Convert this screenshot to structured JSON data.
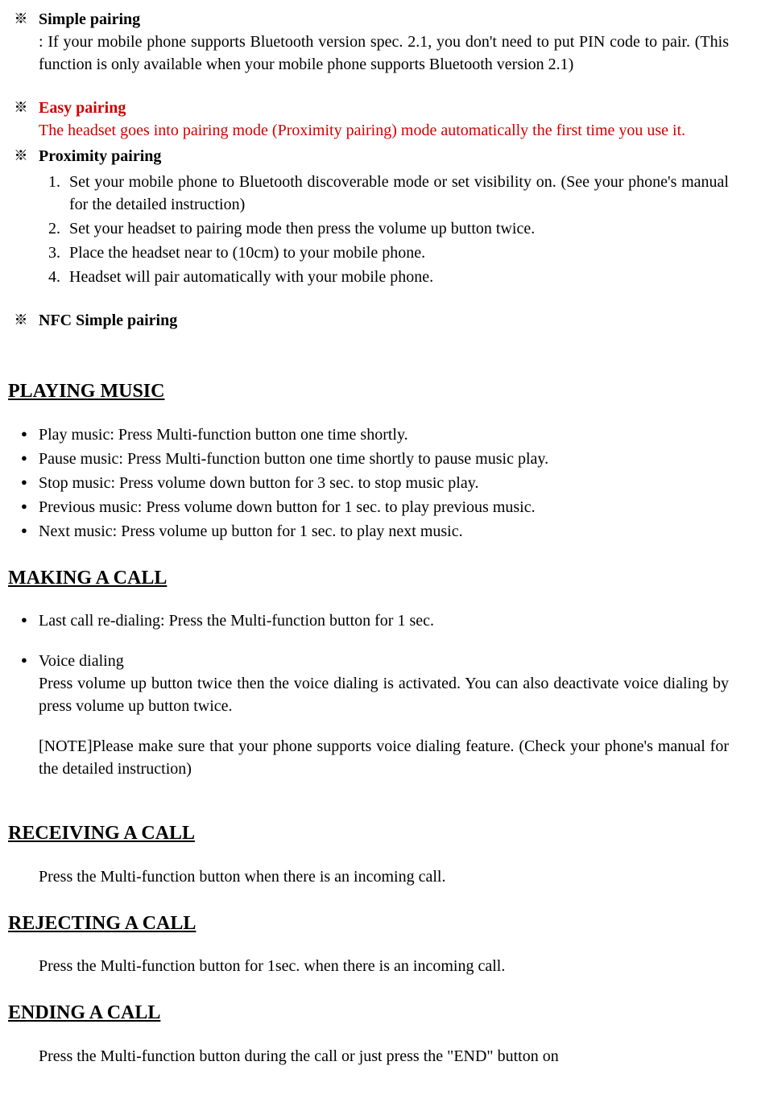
{
  "pairing": {
    "simple": {
      "title": "Simple pairing",
      "body": ": If your mobile phone supports Bluetooth version spec. 2.1, you don't need to put PIN code to pair. (This function is only available when your mobile phone supports Bluetooth version 2.1)"
    },
    "easy": {
      "title": "Easy pairing",
      "body": "The headset goes into pairing mode (Proximity pairing) mode automatically the first time you use it."
    },
    "proximity": {
      "title": "Proximity pairing",
      "steps": [
        "Set your mobile phone to Bluetooth discoverable mode or set visibility on. (See your phone's manual for the detailed instruction)",
        "Set your headset to pairing mode then press the volume up button twice.",
        "Place the headset near to (10cm) to your mobile phone.",
        "Headset will pair automatically with your mobile phone."
      ]
    },
    "nfc": {
      "title": "NFC Simple pairing"
    }
  },
  "playing": {
    "heading": "PLAYING MUSIC",
    "items": [
      "Play music: Press Multi-function button one time shortly.",
      "Pause music: Press Multi-function button one time shortly to pause music play.",
      "Stop music: Press volume down button for 3 sec. to stop music play.",
      "Previous music: Press volume down button for 1 sec. to play previous music.",
      "Next music: Press volume up button for 1 sec. to play next music."
    ]
  },
  "making": {
    "heading": "MAKING A CALL",
    "redial": "Last call re-dialing: Press the Multi-function button for 1 sec.",
    "voice_title": "Voice dialing",
    "voice_body": "Press volume up button twice then the voice dialing is activated. You can also deactivate voice dialing by press volume up button twice.",
    "voice_note": "[NOTE]Please make sure that your phone supports voice dialing feature. (Check your phone's manual for the detailed instruction)"
  },
  "receiving": {
    "heading": "RECEIVING A CALL",
    "body": "Press the Multi-function button when there is an incoming call."
  },
  "rejecting": {
    "heading": "REJECTING A CALL",
    "body": "Press the Multi-function button for 1sec. when there is an incoming call."
  },
  "ending": {
    "heading": "ENDING A CALL",
    "body": "Press the Multi-function button during the call or just press the \"END\" button on"
  }
}
